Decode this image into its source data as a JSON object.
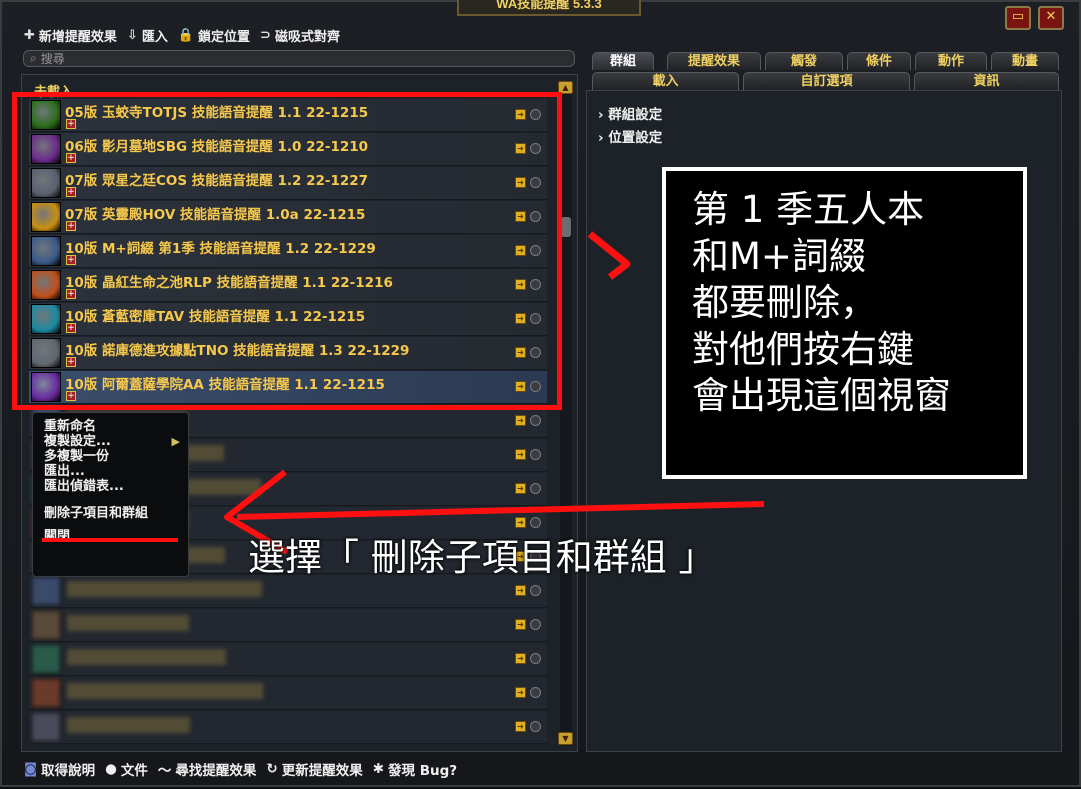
{
  "window": {
    "title": "WA技能提醒 5.3.3",
    "minimize_label": "▭",
    "close_label": "✕"
  },
  "toolbar": {
    "new_aura": "新增提醒效果",
    "import": "匯入",
    "lock_position": "鎖定位置",
    "magnetic_align": "磁吸式對齊"
  },
  "search": {
    "placeholder": "搜尋"
  },
  "list": {
    "section_header": "未載入",
    "auras": [
      {
        "name": "05版 玉蛟寺TOTJS 技能語音提醒 1.1 22-1215",
        "icon_color": "#2a6e1a"
      },
      {
        "name": "06版 影月墓地SBG 技能語音提醒 1.0 22-1210",
        "icon_color": "#6a2a8a"
      },
      {
        "name": "07版 眾星之廷COS 技能語音提醒 1.2 22-1227",
        "icon_color": "#5a6070"
      },
      {
        "name": "07版 英靈殿HOV 技能語音提醒 1.0a 22-1215",
        "icon_color": "#c89010"
      },
      {
        "name": "10版 M+詞綴 第1季 技能語音提醒 1.2 22-1229",
        "icon_color": "#3a5a8a"
      },
      {
        "name": "10版 晶紅生命之池RLP 技能語音提醒 1.1 22-1216",
        "icon_color": "#c0501a"
      },
      {
        "name": "10版 蒼藍密庫TAV 技能語音提醒 1.1 22-1215",
        "icon_color": "#1a8aa0"
      },
      {
        "name": "10版 諾庫德進攻據點TNO 技能語音提醒 1.3 22-1229",
        "icon_color": "#606870"
      },
      {
        "name": "10版 阿爾蓋薩學院AA 技能語音提醒 1.1 22-1215",
        "icon_color": "#6a2aa0"
      }
    ]
  },
  "context_menu": {
    "items": [
      "重新命名",
      "複製設定...",
      "多複製一份",
      "匯出...",
      "匯出偵錯表...",
      "刪除子項目和群組",
      "關閉"
    ]
  },
  "tabs": {
    "row1": [
      "群組",
      "提醒效果",
      "觸發",
      "條件",
      "動作",
      "動畫"
    ],
    "row2": [
      "載入",
      "自訂選項",
      "資訊"
    ]
  },
  "settings": {
    "group_settings": "群組設定",
    "position_settings": "位置設定"
  },
  "annotation": {
    "lines": [
      "第 1 季五人本",
      "和M+詞綴",
      "都要刪除，",
      "對他們按右鍵",
      "會出現這個視窗"
    ],
    "caption": "選擇「 刪除子項目和群組 」"
  },
  "footer": {
    "get_help": "取得說明",
    "docs": "文件",
    "find_auras": "尋找提醒效果",
    "update_auras": "更新提醒效果",
    "found_bug": "發現 Bug?"
  },
  "colors": {
    "accent_gold": "#f6c84c",
    "annotation_red": "#ff1010"
  }
}
